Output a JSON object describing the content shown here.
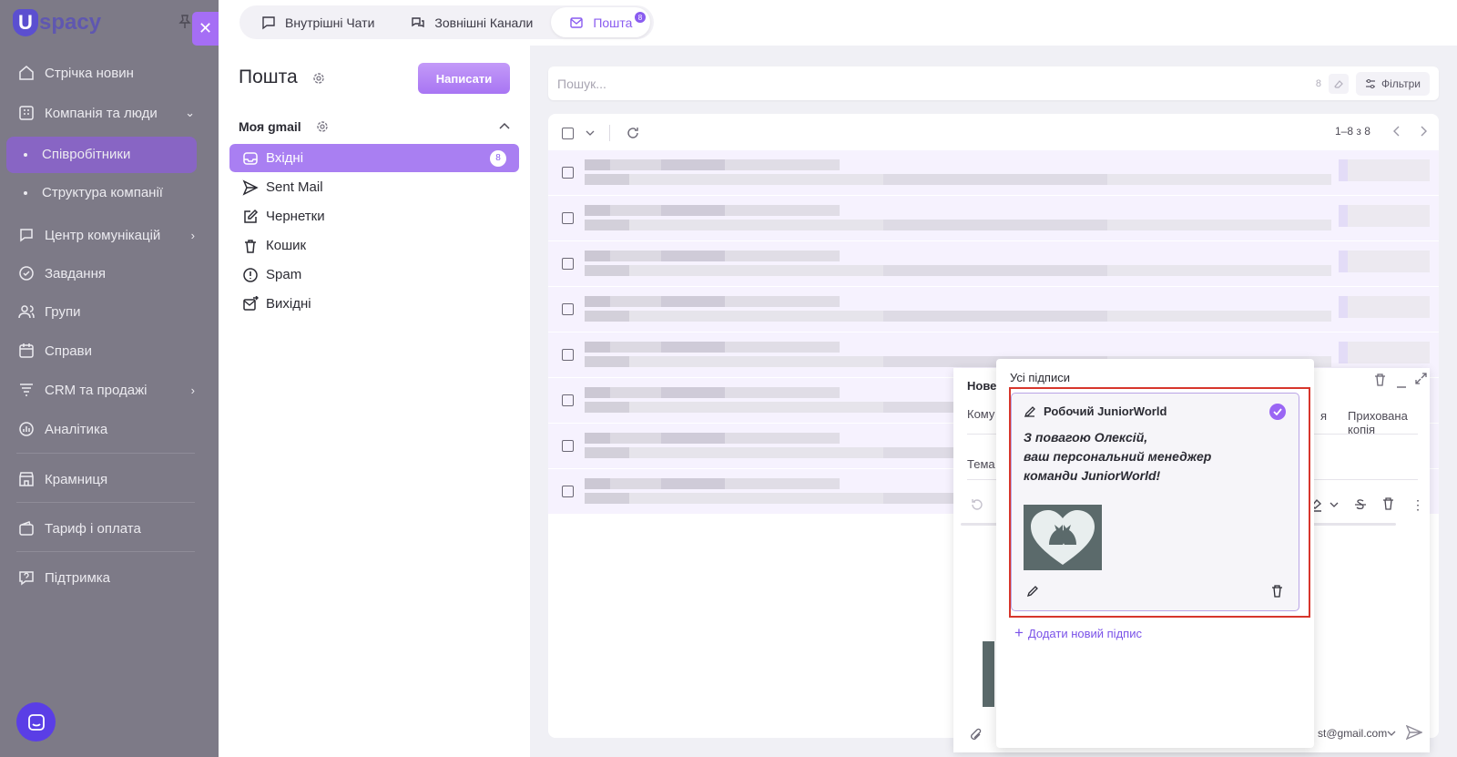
{
  "sidebar": {
    "logo_letter": "U",
    "logo_rest": "spacy",
    "items": [
      {
        "label": "Стрічка новин",
        "icon": "home-icon"
      },
      {
        "label": "Компанія та люди",
        "icon": "building-icon"
      },
      {
        "label": "Співробітники"
      },
      {
        "label": "Структура компанії"
      },
      {
        "label": "Центр комунікацій",
        "icon": "chat-icon"
      },
      {
        "label": "Завдання",
        "icon": "check-circle-icon"
      },
      {
        "label": "Групи",
        "icon": "users-icon"
      },
      {
        "label": "Справи",
        "icon": "calendar-icon"
      },
      {
        "label": "CRM та продажі",
        "icon": "funnel-icon"
      },
      {
        "label": "Аналітика",
        "icon": "chart-icon"
      },
      {
        "label": "Крамниця",
        "icon": "store-icon"
      },
      {
        "label": "Тариф і оплата",
        "icon": "wallet-icon"
      },
      {
        "label": "Підтримка",
        "icon": "help-icon"
      }
    ]
  },
  "topbar": {
    "tabs": [
      {
        "label": "Внутрішні Чати"
      },
      {
        "label": "Зовнішні Канали"
      },
      {
        "label": "Пошта",
        "badge": "8"
      }
    ]
  },
  "mail": {
    "title": "Пошта",
    "write": "Написати",
    "account": "Моя gmail",
    "folders": [
      {
        "label": "Вхідні",
        "badge": "8"
      },
      {
        "label": "Sent Mail"
      },
      {
        "label": "Чернетки"
      },
      {
        "label": "Кошик"
      },
      {
        "label": "Spam"
      },
      {
        "label": "Вихідні"
      }
    ]
  },
  "search": {
    "placeholder": "Пошук...",
    "count": "8",
    "filters": "Фільтри"
  },
  "list": {
    "pagination": "1–8 з 8",
    "rows": 8
  },
  "compose": {
    "title": "Нове",
    "to": "Кому",
    "hidden_copy": "Прихована копія",
    "copy_partial": "я",
    "subject": "Тема",
    "from": "st@gmail.com"
  },
  "signatures": {
    "title": "Усі підписи",
    "card_name": "Робочий JuniorWorld",
    "card_text": "З повагою Олексій,\nваш персональний менеджер\nкоманди JuniorWorld!",
    "add_label": "Додати новий підпис"
  },
  "colors": {
    "accent": "#8a5cf0",
    "sidebar_bg": "#7d7a87",
    "highlight": "#d7362c"
  }
}
